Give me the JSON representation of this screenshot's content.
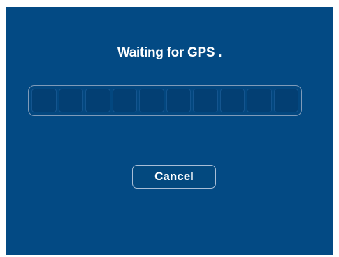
{
  "dialog": {
    "title": "Waiting for GPS .",
    "progress": {
      "segment_count": 10,
      "filled_segments": 0
    },
    "cancel_label": "Cancel"
  },
  "colors": {
    "background": "#034a84",
    "text": "#ffffff",
    "outline": "#7f9bb9"
  }
}
